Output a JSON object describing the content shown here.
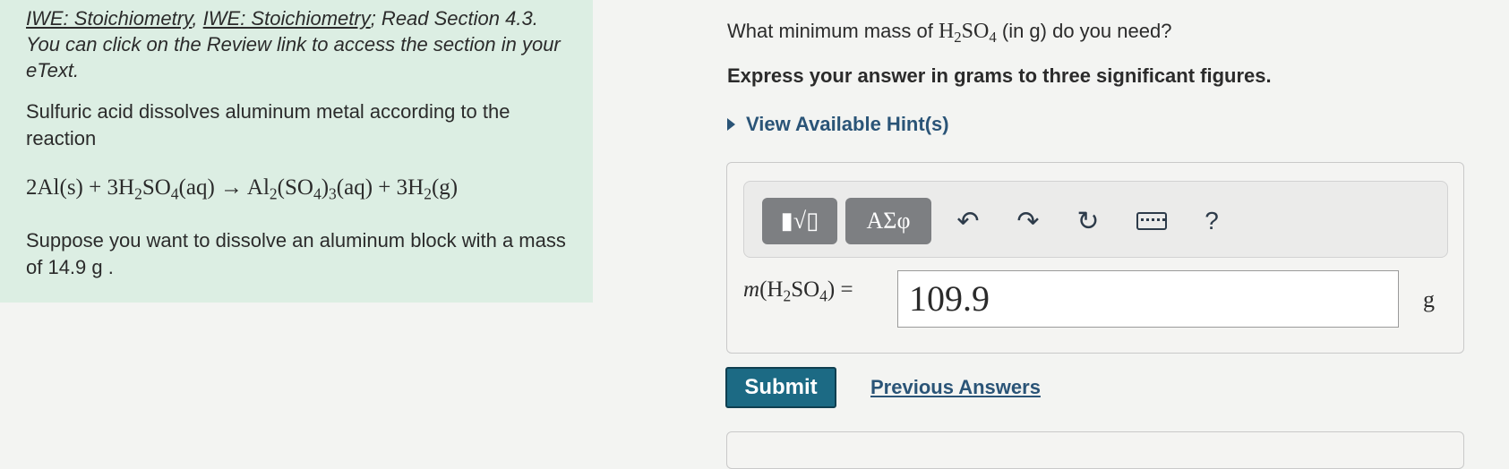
{
  "problem": {
    "intro_link_1": "IWE: Stoichiometry",
    "intro_sep_1": ", ",
    "intro_link_2": "IWE: Stoichiometry",
    "intro_sep_2": "; Read Section 4.3. You can click on the Review link to access the section in your eText.",
    "statement": "Sulfuric acid dissolves aluminum metal according to the reaction",
    "equation": {
      "reactant_1": "2Al(s)",
      "plus_1": " + ",
      "reactant_2_coef": "3H",
      "reactant_2_sub": "2",
      "reactant_2_mid": "SO",
      "reactant_2_sub2": "4",
      "reactant_2_state": "(aq)",
      "arrow": " → ",
      "product_1": "Al",
      "product_1_sub": "2",
      "product_1_mid": "(SO",
      "product_1_sub2": "4",
      "product_1_close": ")",
      "product_1_sub3": "3",
      "product_1_state": "(aq)",
      "plus_2": " + ",
      "product_2": "3H",
      "product_2_sub": "2",
      "product_2_state": "(g)"
    },
    "supposition": "Suppose you want to dissolve an aluminum block with a mass of 14.9 g ."
  },
  "question": {
    "prefix": "What minimum mass of ",
    "chem_a": "H",
    "chem_sub_a": "2",
    "chem_b": "SO",
    "chem_sub_b": "4",
    "suffix": " (in g) do you need?",
    "instruction": "Express your answer in grams to three significant figures.",
    "hint_label": "View Available Hint(s)"
  },
  "answer": {
    "toolbar": {
      "templates_glyph": "▮√▯",
      "symbols_label": "ΑΣφ",
      "undo_icon": "↶",
      "redo_icon": "↷",
      "reset_icon": "↻",
      "help_label": "?"
    },
    "var_m": "m",
    "var_open": "(H",
    "var_sub_a": "2",
    "var_mid": "SO",
    "var_sub_b": "4",
    "var_close": ") =",
    "value": "109.9",
    "unit": "g"
  },
  "actions": {
    "submit_label": "Submit",
    "previous_answers_label": "Previous Answers"
  }
}
